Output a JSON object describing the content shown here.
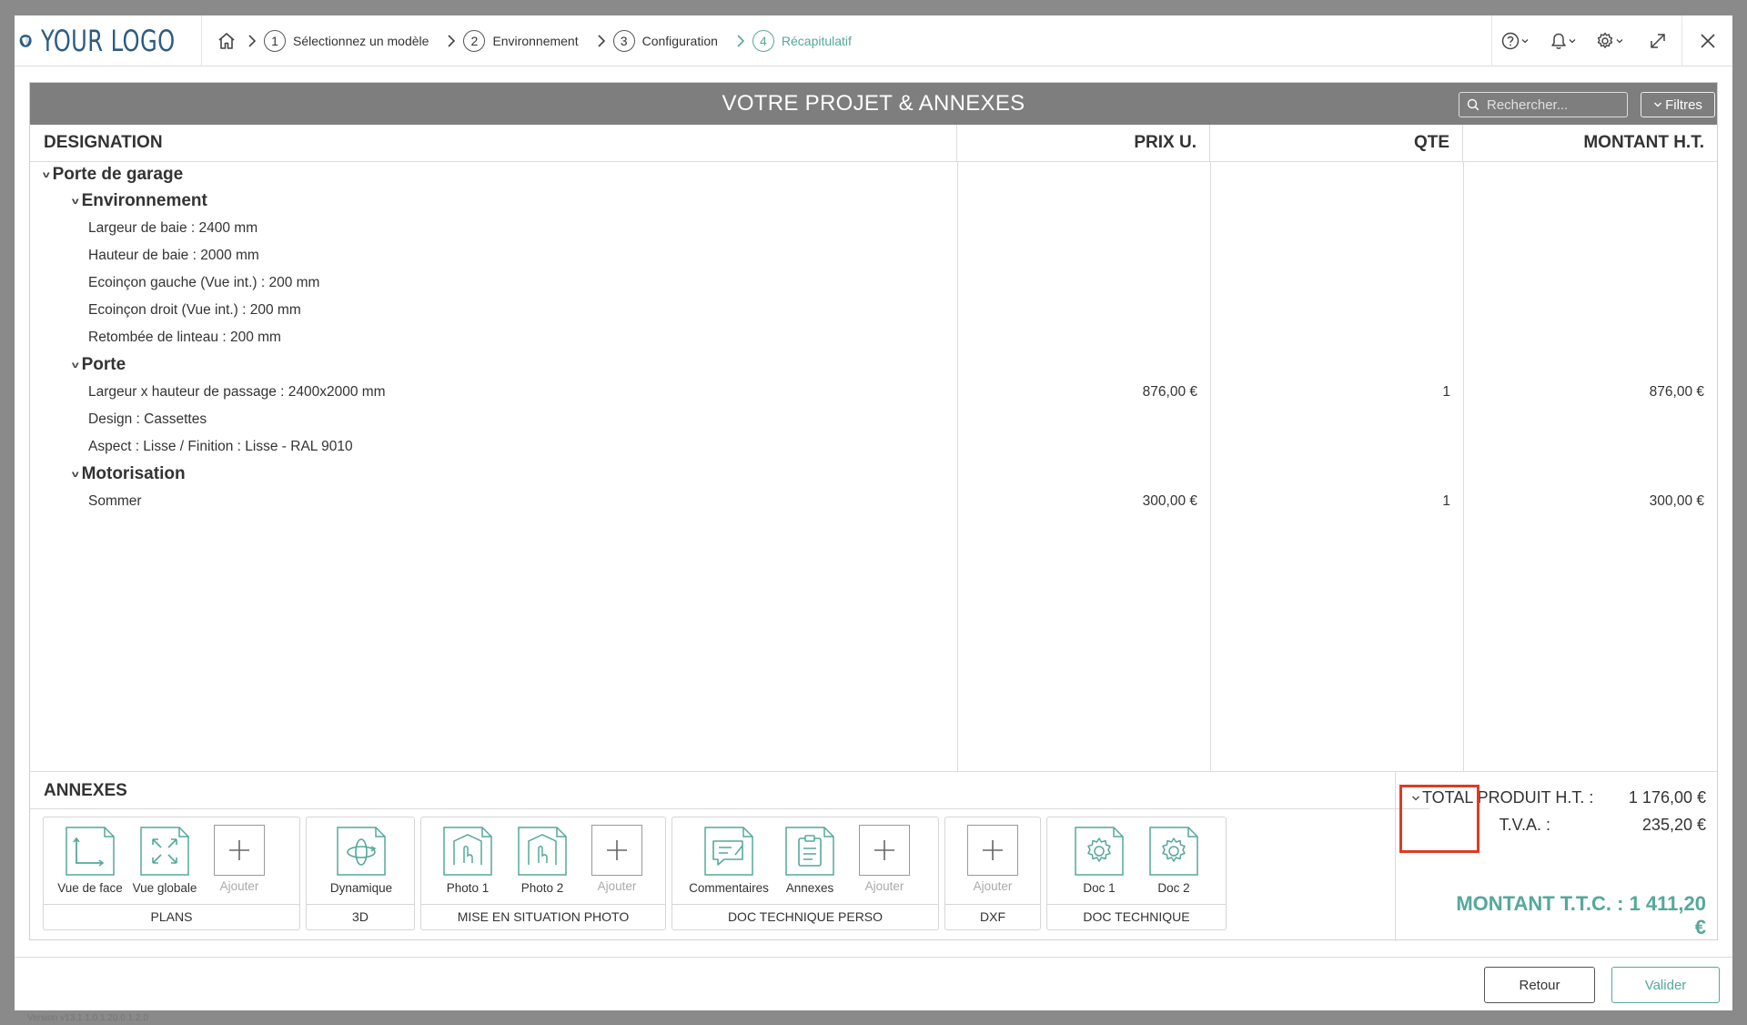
{
  "header": {
    "logo_text": "YOUR LOGO",
    "steps": [
      {
        "num": "1",
        "label": "Sélectionnez un modèle"
      },
      {
        "num": "2",
        "label": "Environnement"
      },
      {
        "num": "3",
        "label": "Configuration"
      },
      {
        "num": "4",
        "label": "Récapitulatif"
      }
    ],
    "active_step": 4,
    "accent_color": "#55a89a"
  },
  "panel": {
    "title": "VOTRE PROJET & ANNEXES",
    "search_placeholder": "Rechercher...",
    "filters_label": "Filtres"
  },
  "table": {
    "headers": {
      "designation": "DESIGNATION",
      "prix": "PRIX U.",
      "qte": "QTE",
      "montant": "MONTANT H.T."
    },
    "rows": [
      {
        "level": 0,
        "type": "group",
        "label": "Porte de garage"
      },
      {
        "level": 1,
        "type": "group",
        "label": "Environnement"
      },
      {
        "level": 2,
        "type": "item",
        "label": "Largeur de baie : 2400 mm",
        "prix": "",
        "qte": "",
        "montant": ""
      },
      {
        "level": 2,
        "type": "item",
        "label": "Hauteur de baie : 2000 mm",
        "prix": "",
        "qte": "",
        "montant": ""
      },
      {
        "level": 2,
        "type": "item",
        "label": "Ecoinçon gauche (Vue int.) : 200 mm",
        "prix": "",
        "qte": "",
        "montant": ""
      },
      {
        "level": 2,
        "type": "item",
        "label": "Ecoinçon droit (Vue int.) : 200 mm",
        "prix": "",
        "qte": "",
        "montant": ""
      },
      {
        "level": 2,
        "type": "item",
        "label": "Retombée de linteau : 200 mm",
        "prix": "",
        "qte": "",
        "montant": ""
      },
      {
        "level": 1,
        "type": "group",
        "label": "Porte"
      },
      {
        "level": 2,
        "type": "item",
        "label": "Largeur x hauteur de passage : 2400x2000 mm",
        "prix": "876,00 €",
        "qte": "1",
        "montant": "876,00 €"
      },
      {
        "level": 2,
        "type": "item",
        "label": "Design : Cassettes",
        "prix": "",
        "qte": "",
        "montant": ""
      },
      {
        "level": 2,
        "type": "item",
        "label": "Aspect : Lisse / Finition : Lisse - RAL 9010",
        "prix": "",
        "qte": "",
        "montant": ""
      },
      {
        "level": 1,
        "type": "group",
        "label": "Motorisation"
      },
      {
        "level": 2,
        "type": "item",
        "label": "Sommer",
        "prix": "300,00 €",
        "qte": "1",
        "montant": "300,00 €"
      }
    ]
  },
  "annexes": {
    "title": "ANNEXES",
    "groups": [
      {
        "label": "PLANS",
        "tiles": [
          {
            "label": "Vue de face",
            "icon": "plan-front-icon"
          },
          {
            "label": "Vue globale",
            "icon": "plan-expand-icon"
          },
          {
            "label": "Ajouter",
            "icon": "plus-icon"
          }
        ]
      },
      {
        "label": "3D",
        "tiles": [
          {
            "label": "Dynamique",
            "icon": "rotate-3d-icon"
          }
        ]
      },
      {
        "label": "MISE EN SITUATION PHOTO",
        "tiles": [
          {
            "label": "Photo 1",
            "icon": "photo-hand-icon"
          },
          {
            "label": "Photo 2",
            "icon": "photo-hand-icon"
          },
          {
            "label": "Ajouter",
            "icon": "plus-icon"
          }
        ]
      },
      {
        "label": "DOC TECHNIQUE PERSO",
        "tiles": [
          {
            "label": "Commentaires",
            "icon": "comment-icon"
          },
          {
            "label": "Annexes",
            "icon": "clipboard-icon"
          },
          {
            "label": "Ajouter",
            "icon": "plus-icon"
          }
        ]
      },
      {
        "label": "DXF",
        "tiles": [
          {
            "label": "Ajouter",
            "icon": "plus-icon"
          }
        ]
      },
      {
        "label": "DOC TECHNIQUE",
        "tiles": [
          {
            "label": "Doc 1",
            "icon": "gear-doc-icon"
          },
          {
            "label": "Doc 2",
            "icon": "gear-doc-icon"
          }
        ]
      }
    ]
  },
  "totals": {
    "ht_label": "TOTAL PRODUIT H.T. :",
    "ht_value": "1 176,00 €",
    "tva_label": "T.V.A. :",
    "tva_value": "235,20 €",
    "ttc_text": "MONTANT T.T.C. : 1 411,20 €"
  },
  "footer": {
    "back_label": "Retour",
    "validate_label": "Valider",
    "version": "Version v13.1.1.0.1.20.0.1.2.0"
  }
}
